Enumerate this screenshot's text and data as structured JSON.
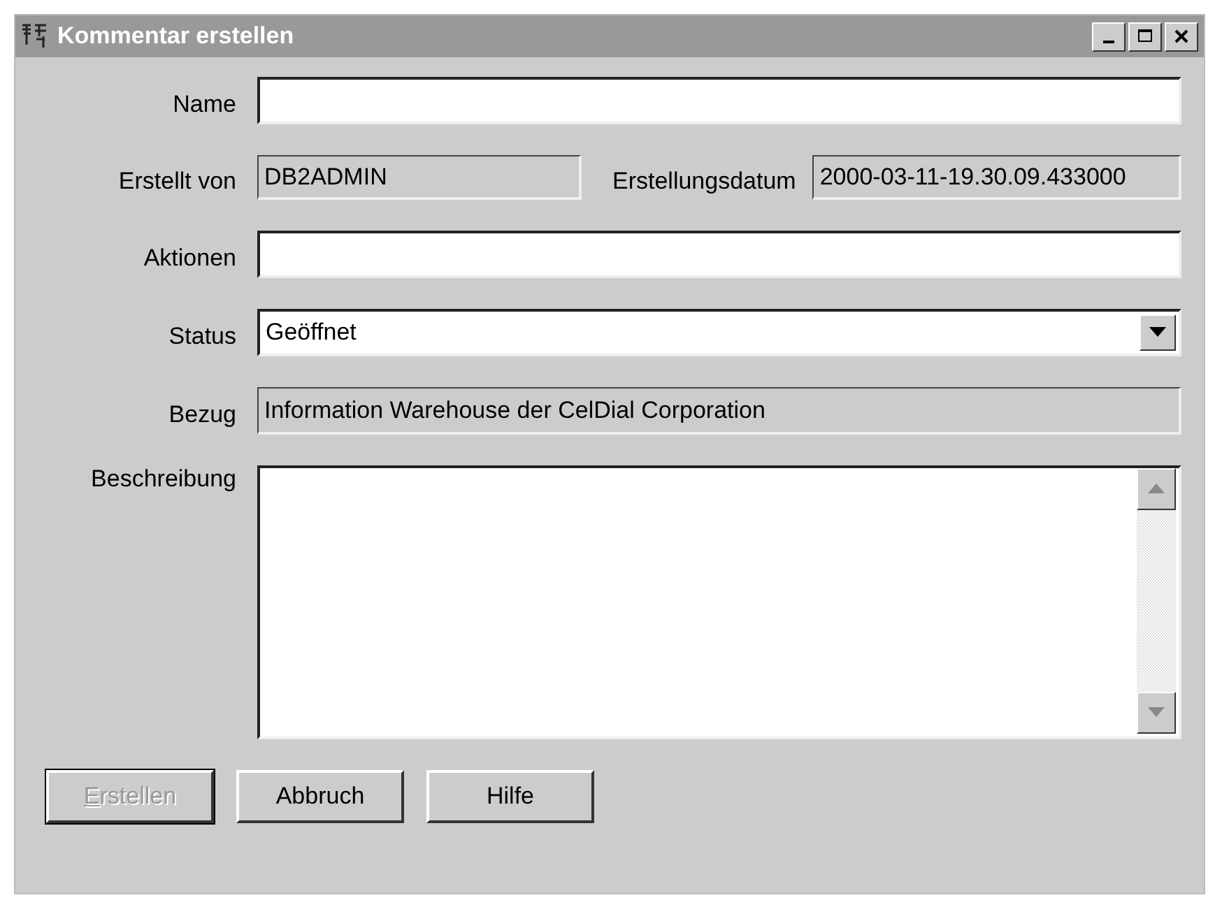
{
  "window": {
    "title": "Kommentar erstellen"
  },
  "fields": {
    "name": {
      "label": "Name"
    },
    "created_by": {
      "label": "Erstellt von",
      "value": "DB2ADMIN",
      "disabled": true
    },
    "created_date": {
      "label": "Erstellungsdatum",
      "value": "2000-03-11-19.30.09.433000",
      "disabled": true
    },
    "actions": {
      "label": "Aktionen"
    },
    "status": {
      "label": "Status",
      "value": "Geöffnet"
    },
    "reference": {
      "label": "Bezug",
      "value": "Information Warehouse der CelDial Corporation",
      "disabled": true
    },
    "description": {
      "label": "Beschreibung"
    }
  },
  "buttons": [
    {
      "label": "Erstellen",
      "disabled": true
    },
    {
      "label": "Abbruch",
      "disabled": false
    },
    {
      "label": "Hilfe",
      "disabled": false
    }
  ]
}
